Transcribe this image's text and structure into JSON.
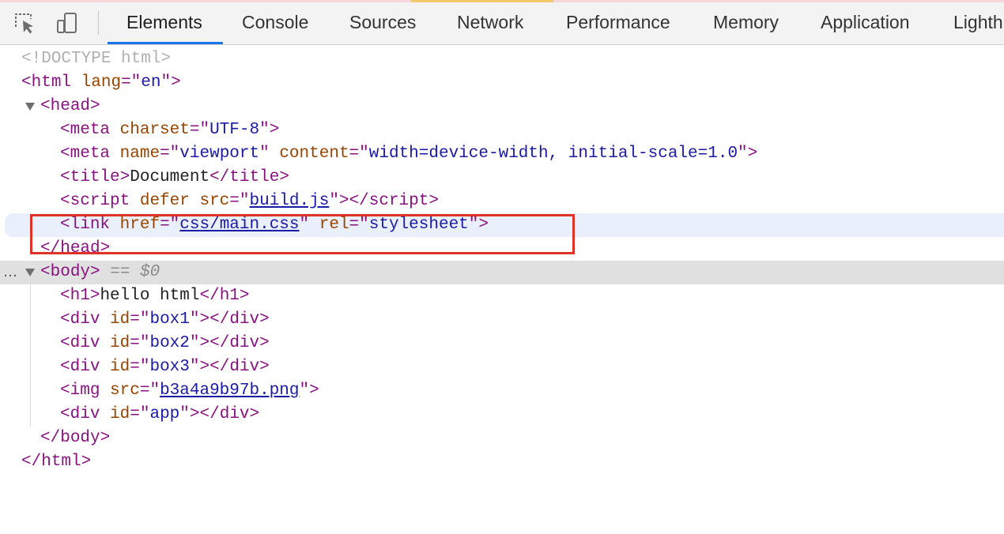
{
  "toolbar": {
    "inspect_icon": "inspect-element-icon",
    "device_icon": "device-toolbar-icon",
    "tabs": [
      {
        "label": "Elements",
        "active": true
      },
      {
        "label": "Console"
      },
      {
        "label": "Sources"
      },
      {
        "label": "Network"
      },
      {
        "label": "Performance"
      },
      {
        "label": "Memory"
      },
      {
        "label": "Application"
      },
      {
        "label": "Lighth"
      }
    ],
    "accent_color": "#1a73e8"
  },
  "tree": {
    "doctype": "<!DOCTYPE html>",
    "html": {
      "tag": "html",
      "attr": "lang",
      "value": "en"
    },
    "head": {
      "tag": "head"
    },
    "meta_charset": {
      "tag": "meta",
      "attr": "charset",
      "value": "UTF-8"
    },
    "meta_viewport": {
      "tag": "meta",
      "attr1": "name",
      "value1": "viewport",
      "attr2": "content",
      "value2": "width=device-width, initial-scale=1.0"
    },
    "title": {
      "tag": "title",
      "text": "Document"
    },
    "script": {
      "tag": "script",
      "attr1": "defer",
      "attr2": "src",
      "value": "build.js"
    },
    "link": {
      "tag": "link",
      "attr1": "href",
      "value1": "css/main.css",
      "attr2": "rel",
      "value2": "stylesheet"
    },
    "head_close": "head",
    "body": {
      "tag": "body",
      "suffix": "== $0",
      "dots": "…"
    },
    "h1": {
      "tag": "h1",
      "text": "hello html"
    },
    "div1": {
      "tag": "div",
      "attr": "id",
      "value": "box1"
    },
    "div2": {
      "tag": "div",
      "attr": "id",
      "value": "box2"
    },
    "div3": {
      "tag": "div",
      "attr": "id",
      "value": "box3"
    },
    "img": {
      "tag": "img",
      "attr": "src",
      "value": "b3a4a9b97b.png"
    },
    "div_app": {
      "tag": "div",
      "attr": "id",
      "value": "app"
    },
    "body_close": "body",
    "html_close": "html"
  },
  "highlight_color": "#e03327"
}
